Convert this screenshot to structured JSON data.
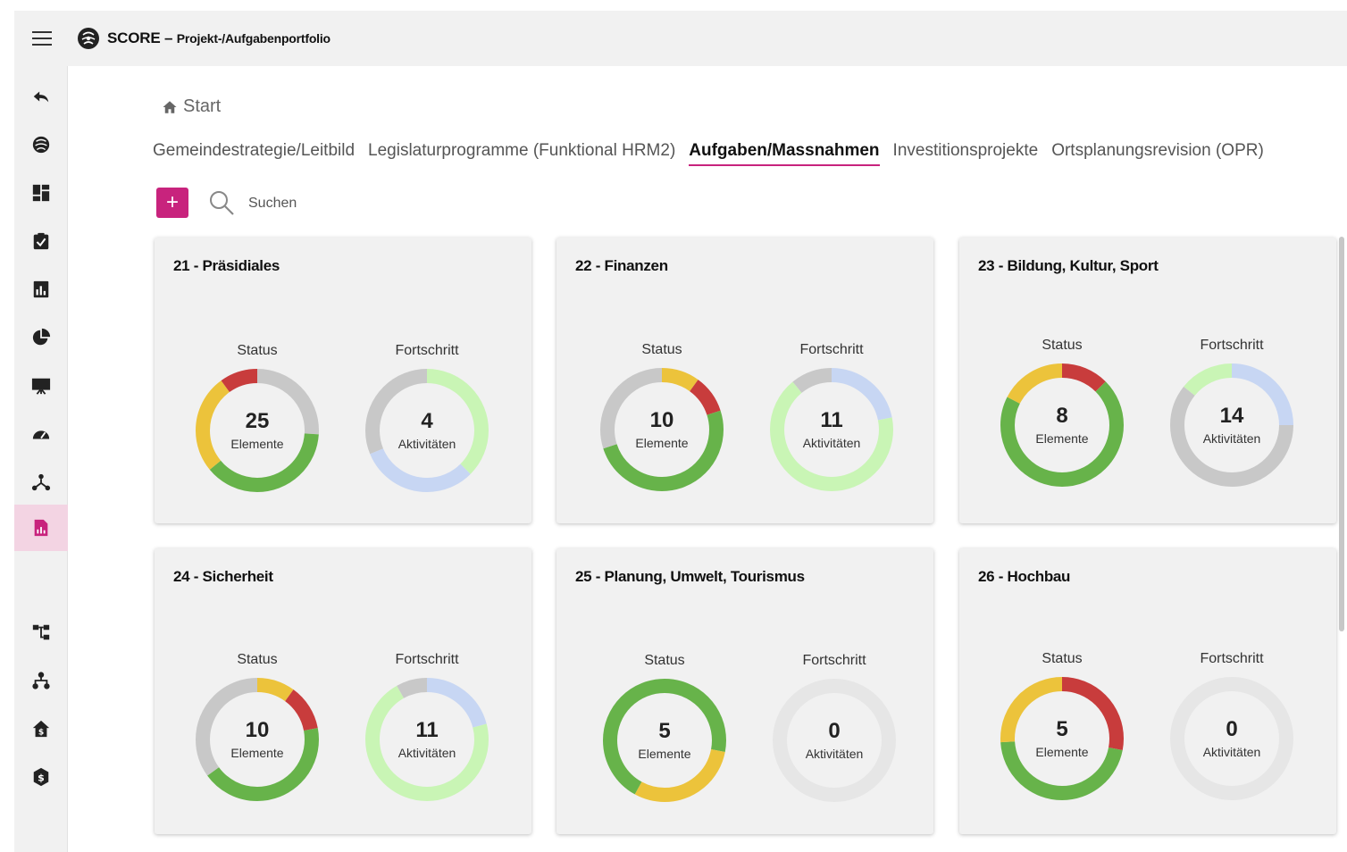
{
  "app": {
    "title": "SCORE",
    "separator": " – ",
    "subtitle": "Projekt-/Aufgabenportfolio"
  },
  "sidebar": {
    "items": [
      {
        "name": "back-icon",
        "active": false
      },
      {
        "name": "globe-icon",
        "active": false
      },
      {
        "name": "dashboard-icon",
        "active": false
      },
      {
        "name": "clipboard-check-icon",
        "active": false
      },
      {
        "name": "report-chart-icon",
        "active": false
      },
      {
        "name": "pie-chart-icon",
        "active": false
      },
      {
        "name": "presentation-icon",
        "active": false
      },
      {
        "name": "gauge-icon",
        "active": false
      },
      {
        "name": "network-icon",
        "active": false
      },
      {
        "name": "document-chart-icon",
        "active": true
      },
      {
        "name": "hierarchy-icon",
        "active": false
      },
      {
        "name": "org-chart-icon",
        "active": false
      },
      {
        "name": "house-dollar-icon",
        "active": false
      },
      {
        "name": "dollar-shield-icon",
        "active": false
      }
    ]
  },
  "breadcrumb": {
    "label": "Start"
  },
  "tabs": [
    {
      "label": "Gemeindestrategie/Leitbild",
      "active": false
    },
    {
      "label": "Legislaturprogramme (Funktional HRM2)",
      "active": false
    },
    {
      "label": "Aufgaben/Massnahmen",
      "active": true
    },
    {
      "label": "Investitionsprojekte",
      "active": false
    },
    {
      "label": "Ortsplanungsrevision (OPR)",
      "active": false
    }
  ],
  "toolbar": {
    "add_label": "+",
    "search_placeholder": "Suchen"
  },
  "labels": {
    "status": "Status",
    "progress": "Fortschritt",
    "elements": "Elemente",
    "activities": "Aktivitäten"
  },
  "colors": {
    "accent": "#c8237d",
    "green": "#67b34a",
    "yellow": "#ecc33b",
    "red": "#c83c3c",
    "gray": "#c8c8c8",
    "light_green": "#c9f5b5",
    "light_blue": "#c7d6f3",
    "empty": "#e6e6e6"
  },
  "cards": [
    {
      "title": "21 - Präsidiales",
      "status": {
        "value": "25",
        "segments": [
          [
            "gray",
            6.5
          ],
          [
            "green",
            9.5
          ],
          [
            "yellow",
            6.5
          ],
          [
            "red",
            2.5
          ]
        ]
      },
      "progress": {
        "value": "4",
        "segments": [
          [
            "light_green",
            1.5
          ],
          [
            "light_blue",
            1.25
          ],
          [
            "gray",
            1.25
          ]
        ]
      }
    },
    {
      "title": "22 - Finanzen",
      "status": {
        "value": "10",
        "segments": [
          [
            "yellow",
            1
          ],
          [
            "red",
            1
          ],
          [
            "green",
            5
          ],
          [
            "gray",
            3
          ]
        ]
      },
      "progress": {
        "value": "11",
        "segments": [
          [
            "light_blue",
            2.4
          ],
          [
            "light_green",
            7.4
          ],
          [
            "gray",
            1.2
          ]
        ]
      }
    },
    {
      "title": "23 - Bildung, Kultur, Sport",
      "status": {
        "value": "8",
        "segments": [
          [
            "red",
            1
          ],
          [
            "green",
            5.6
          ],
          [
            "yellow",
            1.4
          ]
        ]
      },
      "progress": {
        "value": "14",
        "segments": [
          [
            "light_blue",
            3.5
          ],
          [
            "gray",
            8.5
          ],
          [
            "light_green",
            2
          ]
        ]
      }
    },
    {
      "title": "24 - Sicherheit",
      "status": {
        "value": "10",
        "segments": [
          [
            "yellow",
            1
          ],
          [
            "red",
            1.2
          ],
          [
            "green",
            4.3
          ],
          [
            "gray",
            3.5
          ]
        ]
      },
      "progress": {
        "value": "11",
        "segments": [
          [
            "light_blue",
            2.3
          ],
          [
            "light_green",
            7.8
          ],
          [
            "gray",
            0.9
          ]
        ]
      }
    },
    {
      "title": "25 - Planung, Umwelt, Tourismus",
      "status": {
        "value": "5",
        "segments": [
          [
            "green",
            1.4
          ],
          [
            "yellow",
            1.5
          ],
          [
            "green",
            2.1
          ]
        ]
      },
      "progress": {
        "value": "0",
        "segments": [
          [
            "empty",
            1
          ]
        ]
      }
    },
    {
      "title": "26 - Hochbau",
      "status": {
        "value": "5",
        "segments": [
          [
            "red",
            1.4
          ],
          [
            "green",
            2.3
          ],
          [
            "yellow",
            1.3
          ]
        ]
      },
      "progress": {
        "value": "0",
        "segments": [
          [
            "empty",
            1
          ]
        ]
      }
    }
  ]
}
